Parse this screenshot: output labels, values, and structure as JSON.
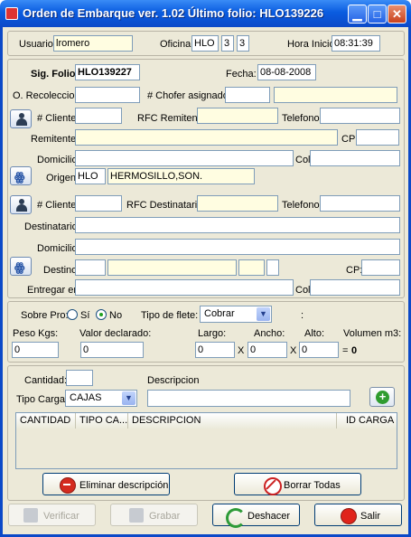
{
  "window": {
    "title": "Orden de Embarque ver. 1.02 Último folio: HLO139226",
    "min": "▁",
    "max": "□",
    "close": "✕"
  },
  "session": {
    "usuario_label": "Usuario:",
    "usuario": "lromero",
    "oficina_label": "Oficina:",
    "oficina": "HLO",
    "oficina_n1": "3",
    "oficina_n2": "3",
    "hora_label": "Hora Inicio:",
    "hora": "08:31:39"
  },
  "folio": {
    "label": "Sig. Folio:",
    "value": "HLO139227",
    "fecha_label": "Fecha:",
    "fecha": "08-08-2008"
  },
  "recoleccion": {
    "label": "O. Recoleccion:",
    "value": "",
    "chofer_label": "# Chofer asignado:",
    "chofer": "",
    "chofer_nombre": ""
  },
  "remitente": {
    "cliente_label": "# Cliente:",
    "cliente": "",
    "rfc_label": "RFC Remitente:",
    "rfc": "",
    "telefono_label": "Telefono:",
    "telefono": "",
    "nombre_label": "Remitente:",
    "nombre": "",
    "cp_label": "CP:",
    "cp": "",
    "domicilio_label": "Domicilio:",
    "domicilio": "",
    "col_label": "Col.",
    "col": "",
    "origen_label": "Origen:",
    "origen_code": "HLO",
    "origen_city": "HERMOSILLO,SON."
  },
  "destinatario": {
    "cliente_label": "# Cliente:",
    "cliente": "",
    "rfc_label": "RFC Destinatario:",
    "rfc": "",
    "telefono_label": "Telefono:",
    "telefono": "",
    "nombre_label": "Destinatario:",
    "nombre": "",
    "domicilio_label": "Domicilio:",
    "domicilio": "",
    "destino_label": "Destino:",
    "destino_code": "",
    "destino_city": "",
    "cp_label": "CP:",
    "cp": "",
    "entregar_label": "Entregar en:",
    "entregar": "",
    "col_label": "Col.",
    "col": ""
  },
  "flete": {
    "sobre_pro_label": "Sobre Pro:",
    "si_label": "Sí",
    "no_label": "No",
    "tipo_label": "Tipo de flete:",
    "tipo": "Cobrar",
    "colon": ":",
    "peso_label": "Peso Kgs:",
    "peso": "0",
    "valor_label": "Valor declarado:",
    "valor": "0",
    "largo_label": "Largo:",
    "largo": "0",
    "ancho_label": "Ancho:",
    "ancho": "0",
    "alto_label": "Alto:",
    "alto": "0",
    "x1": "X",
    "x2": "X",
    "volumen_label": "Volumen m3:",
    "eq": "=",
    "volumen": "0"
  },
  "carga": {
    "cantidad_label": "Cantidad:",
    "cantidad": "",
    "descripcion_label": "Descripcion",
    "descripcion": "",
    "tipo_label": "Tipo Carga:",
    "tipo": "CAJAS",
    "columns": [
      "CANTIDAD",
      "TIPO CA...",
      "DESCRIPCION",
      "ID CARGA"
    ]
  },
  "buttons": {
    "eliminar": "Eliminar descripción",
    "borrar": "Borrar Todas",
    "verificar": "Verificar",
    "grabar": "Grabar",
    "deshacer": "Deshacer",
    "salir": "Salir"
  }
}
